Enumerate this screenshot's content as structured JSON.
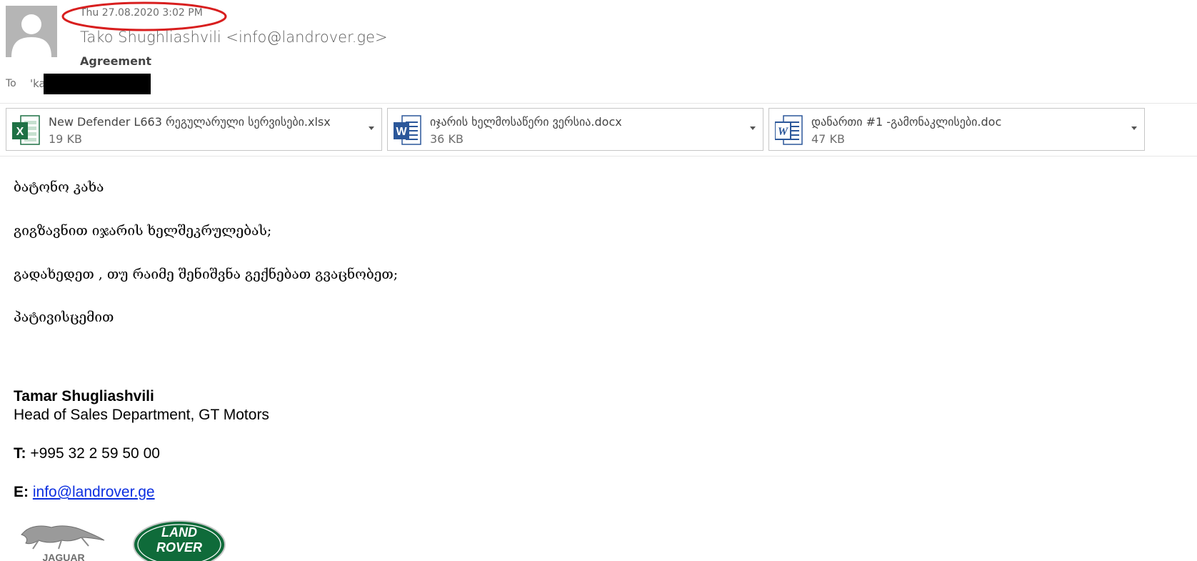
{
  "header": {
    "datetime": "Thu 27.08.2020 3:02 PM",
    "sender": "Tako Shughliashvili <info@landrover.ge>",
    "subject": "Agreement",
    "to_label": "To",
    "to_value": "'ka"
  },
  "attachments": [
    {
      "name": "New Defender L663 რეგულარული სერვისები.xlsx",
      "size": "19 KB",
      "icon": "excel-icon"
    },
    {
      "name": "იჯარის ხელმოსაწერი ვერსია.docx",
      "size": "36 KB",
      "icon": "word-icon"
    },
    {
      "name": "დანართი #1 -გამონაკლისები.doc",
      "size": "47 KB",
      "icon": "word-icon"
    }
  ],
  "body": {
    "lines": [
      "ბატონო კახა",
      "გიგზავნით იჯარის ხელშეკრულებას;",
      "გადახედეთ , თუ რაიმე შენიშვნა გექნებათ გვაცნობეთ;",
      "პატივისცემით"
    ]
  },
  "signature": {
    "name": "Tamar Shugliashvili",
    "title": "Head of Sales Department, GT Motors",
    "phone_label": "T:",
    "phone": "+995 32 2 59 50 00",
    "email_label": "E:",
    "email": "info@landrover.ge",
    "logo_jaguar": "JAGUAR",
    "logo_landrover_1": "LAND",
    "logo_landrover_2": "ROVER"
  },
  "colors": {
    "annotation": "#d81e1e",
    "link": "#0b2ee0",
    "landrover_green": "#0f6b3a",
    "excel_green": "#1e7145",
    "word_blue": "#2b579a"
  }
}
